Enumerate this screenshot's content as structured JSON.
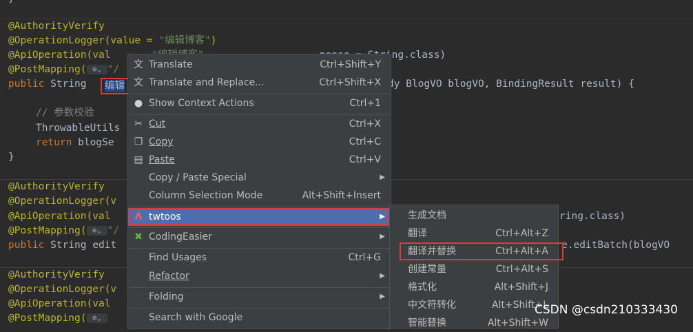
{
  "code": {
    "block1": {
      "ann1": "@AuthorityVerify",
      "ann2_prefix": "@OperationLogger(value = ",
      "ann2_str": "\"编辑博客\"",
      "ann2_suffix": ")",
      "ann3_prefix": "@ApiOperation(val",
      "ann3_mid": "\"编辑博客\"",
      "ann3_suffix": "ponse = String.class)",
      "ann4_prefix": "@PostMapping(",
      "ann4_suffix": "\"/",
      "sig_kw": "public",
      "sig_type": " String ",
      "selected_word": "编辑",
      "sig_suffix": "dy BlogVO blogVO, BindingResult result) {",
      "comment": "// 参数校验",
      "line_throwable": "ThrowableUtils",
      "line_return_kw": "return",
      "line_return_rest": " blogSe",
      "close_brace": "}"
    },
    "block2": {
      "ann1": "@AuthorityVerify",
      "ann2": "@OperationLogger(v",
      "ann3": "@ApiOperation(val",
      "ann3_suffix": "ring.class)",
      "ann4_prefix": "@PostMapping(",
      "ann4_suffix": "\"/",
      "sig_kw": "public",
      "sig_rest": " String edit",
      "sig_suffix": "e.editBatch(blogVO"
    },
    "block3": {
      "ann1": "@AuthorityVerify",
      "ann2": "@OperationLogger(v",
      "ann3": "@ApiOperation(val",
      "ann4_prefix": "@PostMapping("
    },
    "globe_icon": "globe-icon"
  },
  "context_menu": {
    "items": [
      {
        "label": "Translate",
        "shortcut": "Ctrl+Shift+Y",
        "icon": "translate-icon"
      },
      {
        "label": "Translate and Replace...",
        "shortcut": "Ctrl+Shift+X",
        "icon": "translate-replace-icon"
      },
      {
        "label": "Show Context Actions",
        "shortcut": "Ctrl+1",
        "icon": "lightbulb-icon"
      },
      {
        "label": "Cut",
        "shortcut": "Ctrl+X",
        "icon": "scissors-icon"
      },
      {
        "label": "Copy",
        "shortcut": "Ctrl+C",
        "icon": "copy-icon"
      },
      {
        "label": "Paste",
        "shortcut": "Ctrl+V",
        "icon": "paste-icon"
      },
      {
        "label": "Copy / Paste Special",
        "shortcut": ""
      },
      {
        "label": "Column Selection Mode",
        "shortcut": "Alt+Shift+Insert"
      },
      {
        "label": "twtoos",
        "shortcut": "",
        "icon": "twtoos-icon"
      },
      {
        "label": "CodingEasier",
        "shortcut": "",
        "icon": "codingeasier-icon"
      },
      {
        "label": "Find Usages",
        "shortcut": "Ctrl+G"
      },
      {
        "label": "Refactor",
        "shortcut": ""
      },
      {
        "label": "Folding",
        "shortcut": ""
      },
      {
        "label": "Search with Google",
        "shortcut": ""
      }
    ]
  },
  "submenu": {
    "items": [
      {
        "label": "生成文档",
        "shortcut": ""
      },
      {
        "label": "翻译",
        "shortcut": "Ctrl+Alt+Z"
      },
      {
        "label": "翻译并替换",
        "shortcut": "Ctrl+Alt+A"
      },
      {
        "label": "创建常量",
        "shortcut": "Ctrl+Alt+S"
      },
      {
        "label": "格式化",
        "shortcut": "Alt+Shift+J"
      },
      {
        "label": "中文符转化",
        "shortcut": "Alt+Shift+L"
      },
      {
        "label": "智能替换",
        "shortcut": "Alt+Shift+W"
      }
    ]
  },
  "watermark": "CSDN @csdn210333430",
  "colors": {
    "menu_bg": "#3c3f41",
    "active_bg": "#4b6eaf",
    "highlight_box": "#e0393c",
    "editor_bg": "#2b2b2b"
  }
}
